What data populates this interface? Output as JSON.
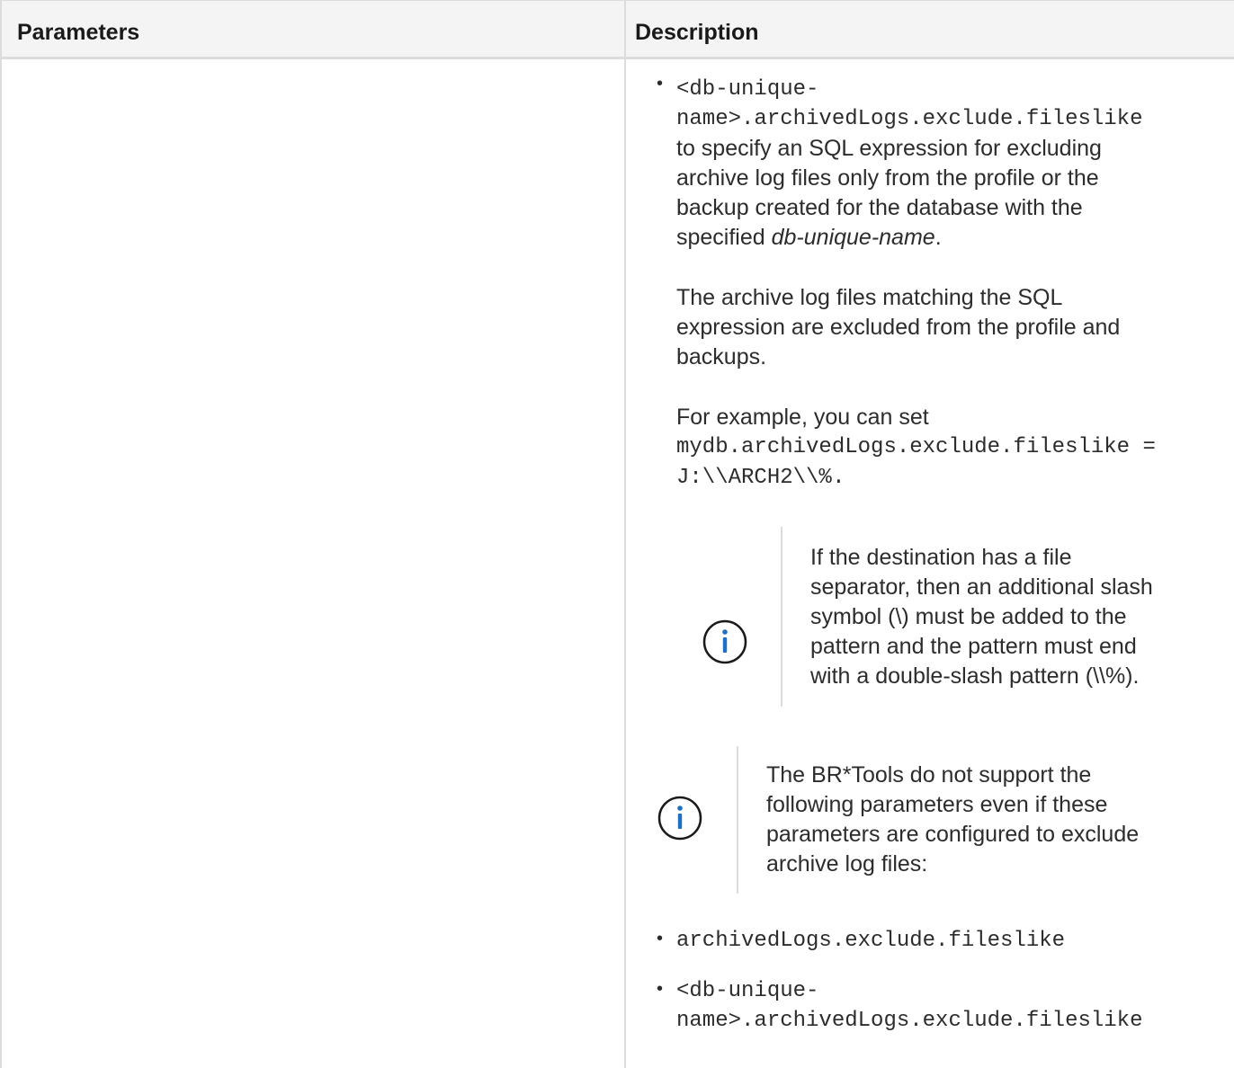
{
  "table": {
    "header": {
      "parameters": "Parameters",
      "description": "Description"
    }
  },
  "description": {
    "item1": {
      "code_line1": "<db-unique-",
      "code_line2": "name>.archivedLogs.exclude.fileslike",
      "text_line1": "to specify an SQL expression for excluding",
      "text_line2": "archive log files only from the profile or the",
      "text_line3": "backup created for the database with the",
      "text_line4_prefix": "specified ",
      "text_line4_italic": "db-unique-name",
      "text_line4_suffix": "."
    },
    "para2": {
      "line1": "The archive log files matching the SQL",
      "line2": "expression are excluded from the profile and",
      "line3": "backups."
    },
    "para3": {
      "line1": "For example, you can set",
      "code_line1": "mydb.archivedLogs.exclude.fileslike =",
      "code_line2": "J:\\\\ARCH2\\\\%",
      "code_line2_suffix": "."
    },
    "note1": {
      "icon": "info-icon",
      "line1": "If the destination has a file",
      "line2": "separator, then an additional slash",
      "line3": "symbol (\\) must be added to the",
      "line4": "pattern and the pattern must end",
      "line5": "with a double-slash pattern (\\\\%)."
    },
    "note2": {
      "icon": "info-icon",
      "line1": "The BR*Tools do not support the",
      "line2": "following parameters even if these",
      "line3": "parameters are configured to exclude",
      "line4": "archive log files:"
    },
    "list2": {
      "item1": "archivedLogs.exclude.fileslike",
      "item2_line1": "<db-unique-",
      "item2_line2": "name>.archivedLogs.exclude.fileslike"
    },
    "bullet_char": "•"
  },
  "colors": {
    "icon_blue": "#1f6fc5",
    "border": "#dcdcdc",
    "header_bg": "#f4f4f4"
  }
}
